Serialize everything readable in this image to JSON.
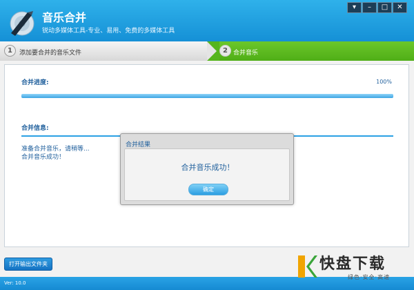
{
  "header": {
    "title": "音乐合并",
    "subtitle": "锐动多媒体工具-专业、易用、免费的多媒体工具",
    "controls": [
      "menu",
      "minimize",
      "maximize",
      "close"
    ]
  },
  "steps": [
    {
      "number": "1",
      "label": "添加要合并的音乐文件"
    },
    {
      "number": "2",
      "label": "合并音乐"
    }
  ],
  "progress": {
    "label": "合并进度:",
    "percent_text": "100%",
    "value": 1.0
  },
  "info": {
    "label": "合并信息:",
    "lines": [
      "准备合并音乐，请稍等...",
      "合并音乐成功！"
    ]
  },
  "dialog": {
    "title": "合并结果",
    "message": "合并音乐成功！",
    "ok_label": "确定"
  },
  "footer": {
    "open_folder_label": "打开输出文件夹",
    "version": "Ver: 10.0"
  },
  "watermark": {
    "logo_text": "快盘下载",
    "slogan": "绿色·安全·高速"
  },
  "colors": {
    "header_blue": "#1590d6",
    "step_active_green": "#55b51d",
    "text_blue": "#1f5f9c",
    "progress_blue": "#3ea5e3"
  }
}
